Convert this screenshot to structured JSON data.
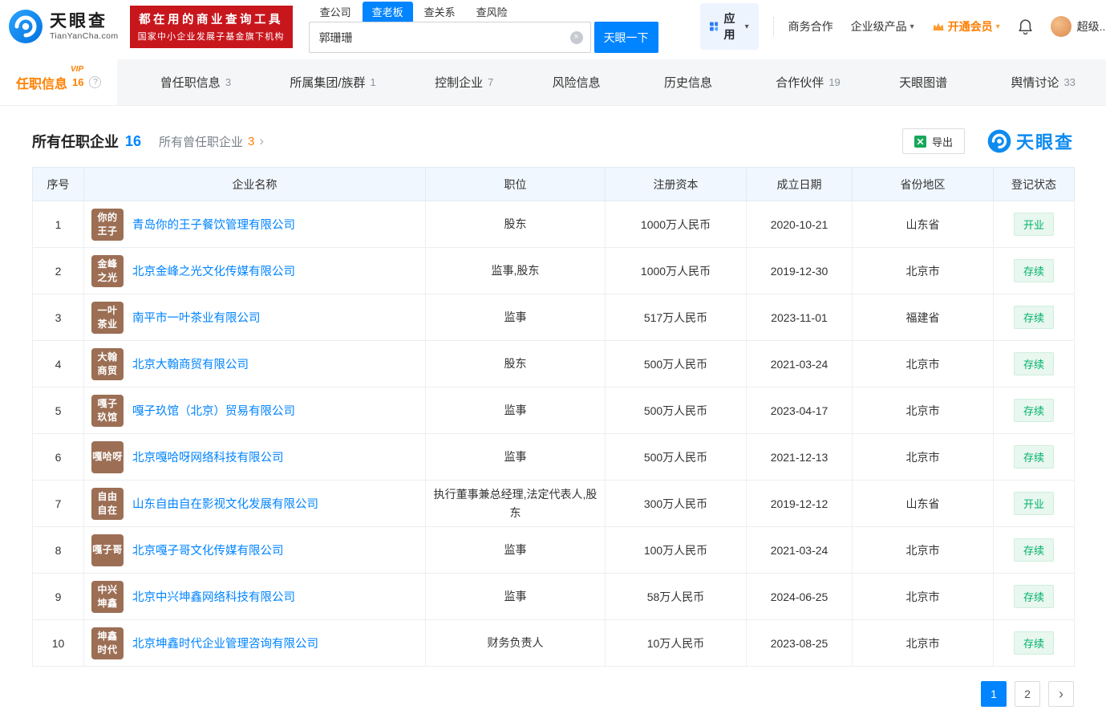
{
  "colors": {
    "brand_blue": "#0084FF",
    "vip_orange": "#FF8000",
    "promo_red": "#C8161D",
    "status_green": "#00B26A",
    "company_icon_brown": "#9C6F55"
  },
  "header": {
    "logo": {
      "name": "天眼查",
      "domain": "TianYanCha.com"
    },
    "promo": {
      "line1": "都在用的商业查询工具",
      "line2": "国家中小企业发展子基金旗下机构"
    },
    "search": {
      "tabs": [
        {
          "label": "查公司",
          "active": false
        },
        {
          "label": "查老板",
          "active": true
        },
        {
          "label": "查关系",
          "active": false
        },
        {
          "label": "查风险",
          "active": false
        }
      ],
      "value": "郭珊珊",
      "button": "天眼一下"
    },
    "apps_label": "应用",
    "links": {
      "cooperation": "商务合作",
      "enterprise": "企业级产品",
      "vip": "开通会员",
      "user": "超级..."
    }
  },
  "nav_tabs": [
    {
      "label": "任职信息",
      "count": "16",
      "active": true,
      "vip": true,
      "help": true
    },
    {
      "label": "曾任职信息",
      "count": "3"
    },
    {
      "label": "所属集团/族群",
      "count": "1"
    },
    {
      "label": "控制企业",
      "count": "7"
    },
    {
      "label": "风险信息",
      "count": ""
    },
    {
      "label": "历史信息",
      "count": ""
    },
    {
      "label": "合作伙伴",
      "count": "19"
    },
    {
      "label": "天眼图谱",
      "count": ""
    },
    {
      "label": "舆情讨论",
      "count": "33"
    }
  ],
  "section": {
    "title": "所有任职企业",
    "title_count": "16",
    "subtitle": "所有曾任职企业",
    "subtitle_count": "3",
    "export_label": "导出",
    "brand": "天眼查"
  },
  "table": {
    "headers": [
      "序号",
      "企业名称",
      "职位",
      "注册资本",
      "成立日期",
      "省份地区",
      "登记状态"
    ],
    "rows": [
      {
        "no": "1",
        "icon": "你的\n王子",
        "name": "青岛你的王子餐饮管理有限公司",
        "position": "股东",
        "capital": "1000万人民币",
        "date": "2020-10-21",
        "region": "山东省",
        "status": "开业"
      },
      {
        "no": "2",
        "icon": "金峰\n之光",
        "name": "北京金峰之光文化传媒有限公司",
        "position": "监事,股东",
        "capital": "1000万人民币",
        "date": "2019-12-30",
        "region": "北京市",
        "status": "存续"
      },
      {
        "no": "3",
        "icon": "一叶\n茶业",
        "name": "南平市一叶茶业有限公司",
        "position": "监事",
        "capital": "517万人民币",
        "date": "2023-11-01",
        "region": "福建省",
        "status": "存续"
      },
      {
        "no": "4",
        "icon": "大翰\n商贸",
        "name": "北京大翰商贸有限公司",
        "position": "股东",
        "capital": "500万人民币",
        "date": "2021-03-24",
        "region": "北京市",
        "status": "存续"
      },
      {
        "no": "5",
        "icon": "嘎子\n玖馆",
        "name": "嘎子玖馆（北京）贸易有限公司",
        "position": "监事",
        "capital": "500万人民币",
        "date": "2023-04-17",
        "region": "北京市",
        "status": "存续"
      },
      {
        "no": "6",
        "icon": "嘎哈呀",
        "name": "北京嘎哈呀网络科技有限公司",
        "position": "监事",
        "capital": "500万人民币",
        "date": "2021-12-13",
        "region": "北京市",
        "status": "存续"
      },
      {
        "no": "7",
        "icon": "自由\n自在",
        "name": "山东自由自在影视文化发展有限公司",
        "position": "执行董事兼总经理,法定代表人,股东",
        "capital": "300万人民币",
        "date": "2019-12-12",
        "region": "山东省",
        "status": "开业"
      },
      {
        "no": "8",
        "icon": "嘎子哥",
        "name": "北京嘎子哥文化传媒有限公司",
        "position": "监事",
        "capital": "100万人民币",
        "date": "2021-03-24",
        "region": "北京市",
        "status": "存续"
      },
      {
        "no": "9",
        "icon": "中兴\n坤鑫",
        "name": "北京中兴坤鑫网络科技有限公司",
        "position": "监事",
        "capital": "58万人民币",
        "date": "2024-06-25",
        "region": "北京市",
        "status": "存续"
      },
      {
        "no": "10",
        "icon": "坤鑫\n时代",
        "name": "北京坤鑫时代企业管理咨询有限公司",
        "position": "财务负责人",
        "capital": "10万人民币",
        "date": "2023-08-25",
        "region": "北京市",
        "status": "存续"
      }
    ]
  },
  "pagination": {
    "pages": [
      {
        "label": "1",
        "active": true
      },
      {
        "label": "2",
        "active": false
      }
    ],
    "next": "›"
  }
}
